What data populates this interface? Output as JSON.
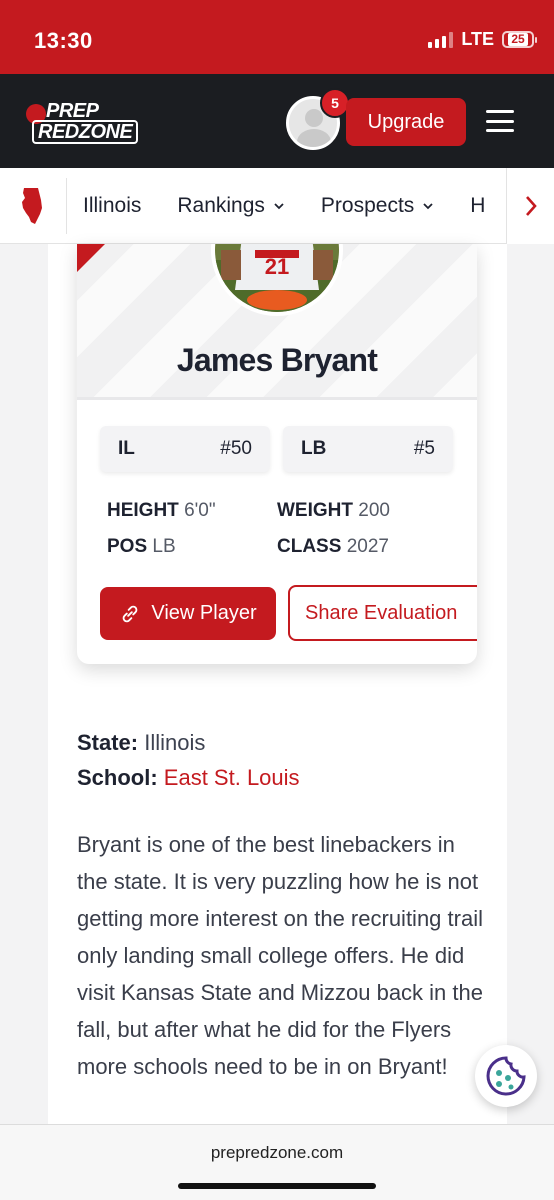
{
  "status_bar": {
    "time": "13:30",
    "network": "LTE",
    "battery": "25"
  },
  "header": {
    "logo_line1": "PREP",
    "logo_line2": "REDZONE",
    "notification_count": "5",
    "upgrade_label": "Upgrade"
  },
  "nav": {
    "items": [
      {
        "label": "Illinois",
        "dropdown": false
      },
      {
        "label": "Rankings",
        "dropdown": true
      },
      {
        "label": "Prospects",
        "dropdown": true
      },
      {
        "label": "H",
        "dropdown": false
      }
    ],
    "chevron": "⌄",
    "next_arrow": "›"
  },
  "player": {
    "name": "James Bryant",
    "state_code": "IL",
    "state_rank": "#50",
    "position_code": "LB",
    "position_rank": "#5",
    "height_label": "HEIGHT",
    "height": "6'0\"",
    "weight_label": "WEIGHT",
    "weight": "200",
    "pos_label": "POS",
    "pos": "LB",
    "class_label": "CLASS",
    "class_year": "2027",
    "view_button": "View Player",
    "share_button": "Share Evaluation"
  },
  "article": {
    "state_label": "State:",
    "state": "Illinois",
    "school_label": "School:",
    "school": "East St. Louis",
    "body": "Bryant is one of the best linebackers in the state.  It is very puzzling how he is not getting more interest on the recruiting trail only landing small college offers.  He did visit Kansas State and Mizzou back in the fall, but after what he did for the Flyers more schools need to be in on Bryant!"
  },
  "browser": {
    "url": "prepredzone.com"
  },
  "colors": {
    "brand_red": "#c41a1f",
    "header_dark": "#1b1d21",
    "cookie_purple": "#4a2f8a"
  },
  "icons": [
    "state-map-icon",
    "chevron-down-icon",
    "chevron-right-icon",
    "link-icon",
    "cookie-icon",
    "menu-icon"
  ]
}
